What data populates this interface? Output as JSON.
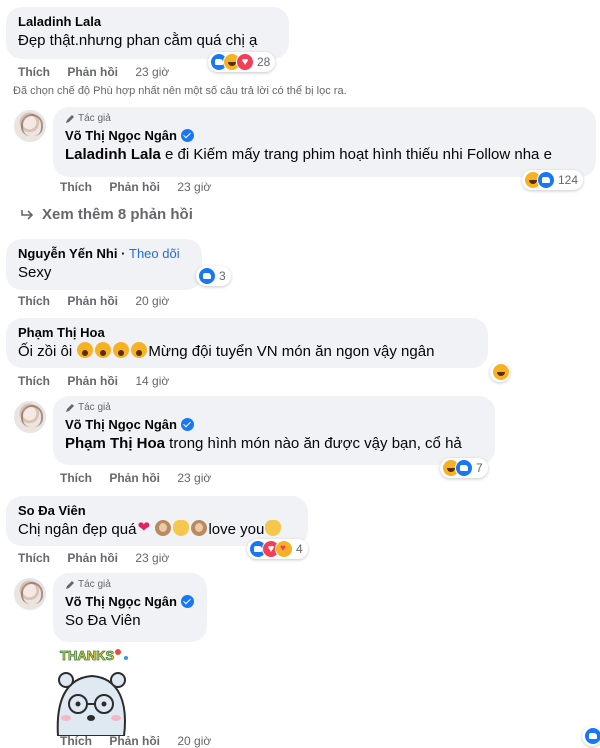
{
  "actions": {
    "like": "Thích",
    "reply": "Phản hồi"
  },
  "author_label": "Tác giả",
  "filter_note": "Đã chọn chế độ Phù hợp nhất nên một số câu trả lời có thể bị lọc ra.",
  "see_more": "Xem thêm 8 phản hồi",
  "comments": [
    {
      "author": "Laladinh Lala",
      "text": "Đẹp thật.nhưng phan cằm quá chị ạ",
      "time": "23 giờ",
      "reactions": [
        "like",
        "haha",
        "love"
      ],
      "count": "28"
    },
    {
      "author": "Võ Thị Ngọc Ngân",
      "tag": "Laladinh Lala",
      "text": " e đi Kiếm mấy trang phim hoạt hình thiếu nhi Follow nha e",
      "time": "23 giờ",
      "reactions": [
        "haha",
        "like"
      ],
      "count": "124"
    },
    {
      "author": "Nguyễn Yến Nhi",
      "follow": "Theo dõi",
      "text": "Sexy",
      "time": "20 giờ",
      "reactions": [
        "like"
      ],
      "count": "3"
    },
    {
      "author": "Phạm Thị Hoa",
      "text_before": "Ối zồi ôi ",
      "text_after": "Mừng đội tuyển VN món ăn ngon vậy ngân",
      "time": "14 giờ",
      "reactions": [
        "haha"
      ],
      "count": ""
    },
    {
      "author": "Võ Thị Ngọc Ngân",
      "tag": "Phạm Thị Hoa",
      "text": " trong hình món nào ăn được vậy bạn, cổ hả",
      "time": "23 giờ",
      "reactions": [
        "haha",
        "like"
      ],
      "count": "7"
    },
    {
      "author": "So Đa Viên",
      "text_before": "Chị ngân đẹp quá",
      "text_after": "love you",
      "time": "23 giờ",
      "reactions": [
        "like",
        "love",
        "care"
      ],
      "count": "4"
    },
    {
      "author": "Võ Thị Ngọc Ngân",
      "tag": "So Đa Viên",
      "time": "20 giờ"
    }
  ],
  "sticker_text": "THANKS",
  "colors": {
    "bubble": "#f0f2f5",
    "meta": "#65676b",
    "link": "#216fdb",
    "like": "#1877f2",
    "love": "#f33e58",
    "haha": "#f7b125"
  }
}
